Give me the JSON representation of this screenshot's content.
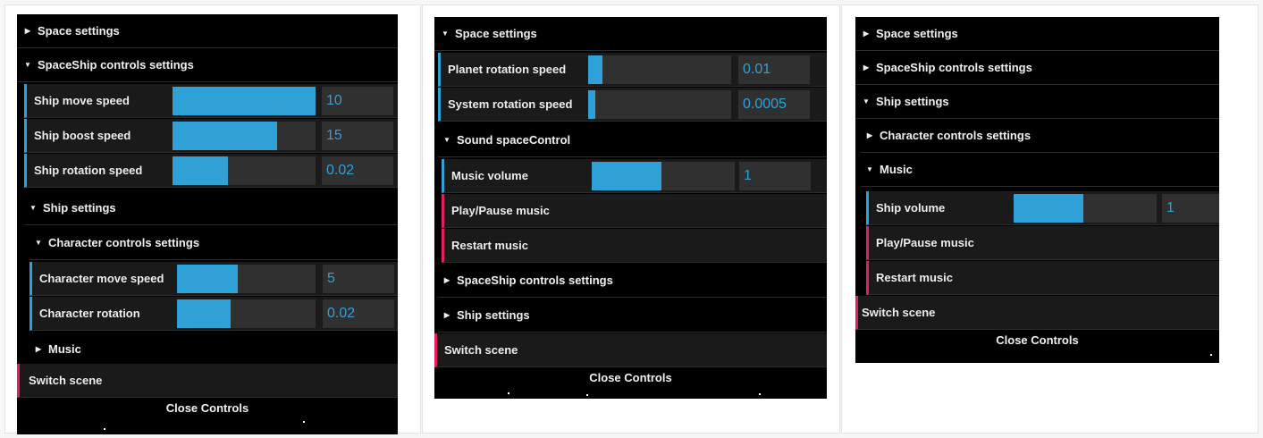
{
  "colors": {
    "number_accent": "#2fa1d6",
    "function_accent": "#e61d5f",
    "panel_bg": "#000000",
    "control_bg": "#1a1a1a",
    "slider_bg": "#303030"
  },
  "icons": {
    "collapsed": "triangle-right-icon",
    "expanded": "triangle-down-icon"
  },
  "panel1": {
    "space_settings": "Space settings",
    "spaceship_controls": "SpaceShip controls settings",
    "ship_move_speed": {
      "label": "Ship move speed",
      "value": "10",
      "fraction": 1.0
    },
    "ship_boost_speed": {
      "label": "Ship boost speed",
      "value": "15",
      "fraction": 0.73
    },
    "ship_rotation_speed": {
      "label": "Ship rotation speed",
      "value": "0.02",
      "fraction": 0.39
    },
    "ship_settings": "Ship settings",
    "character_controls": "Character controls settings",
    "character_move_speed": {
      "label": "Character move speed",
      "value": "5",
      "fraction": 0.44
    },
    "character_rotation": {
      "label": "Character rotation",
      "value": "0.02",
      "fraction": 0.39
    },
    "music": "Music",
    "switch_scene": "Switch scene",
    "close_controls": "Close Controls"
  },
  "panel2": {
    "space_settings": "Space settings",
    "planet_rotation_speed": {
      "label": "Planet rotation speed",
      "value": "0.01",
      "fraction": 0.1
    },
    "system_rotation_speed": {
      "label": "System rotation speed",
      "value": "0.0005",
      "fraction": 0.05
    },
    "sound_space_control": "Sound spaceControl",
    "music_volume": {
      "label": "Music volume",
      "value": "1",
      "fraction": 0.49
    },
    "play_pause_music": "Play/Pause music",
    "restart_music": "Restart music",
    "spaceship_controls": "SpaceShip controls settings",
    "ship_settings": "Ship settings",
    "switch_scene": "Switch scene",
    "close_controls": "Close Controls"
  },
  "panel3": {
    "space_settings": "Space settings",
    "spaceship_controls": "SpaceShip controls settings",
    "ship_settings": "Ship settings",
    "character_controls": "Character controls settings",
    "music": "Music",
    "ship_volume": {
      "label": "Ship volume",
      "value": "1",
      "fraction": 0.49
    },
    "play_pause_music": "Play/Pause music",
    "restart_music": "Restart music",
    "switch_scene": "Switch scene",
    "close_controls": "Close Controls"
  }
}
